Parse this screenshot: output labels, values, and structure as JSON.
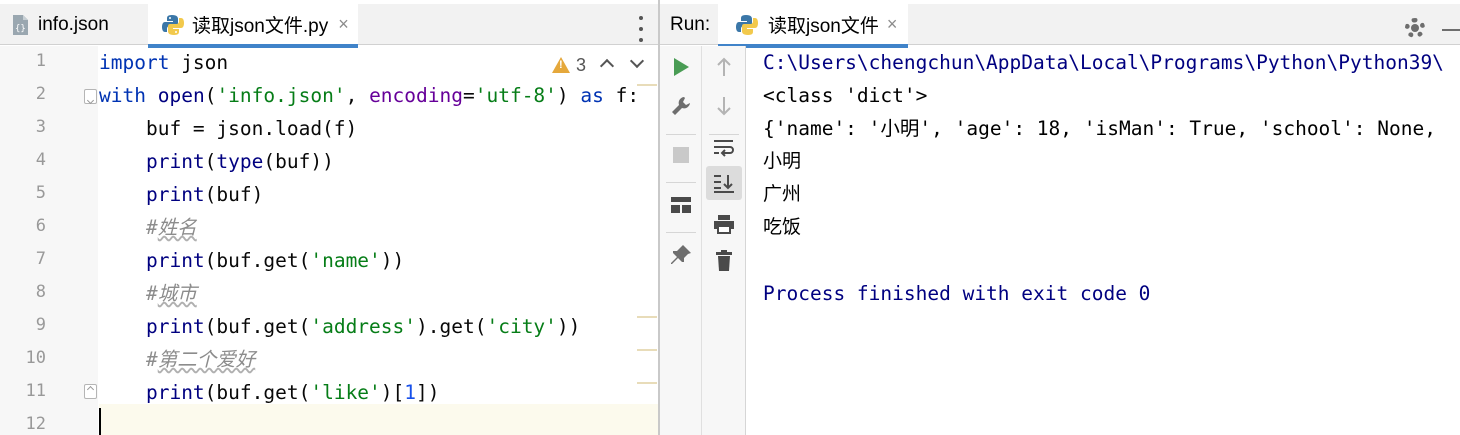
{
  "editor": {
    "tabs": [
      {
        "label": "info.json",
        "icon": "json-file-icon"
      },
      {
        "label": "读取json文件.py",
        "icon": "python-file-icon",
        "active": true
      }
    ],
    "close_glyph": "×",
    "inspections": {
      "warnings": "3"
    },
    "line_numbers": [
      "1",
      "2",
      "3",
      "4",
      "5",
      "6",
      "7",
      "8",
      "9",
      "10",
      "11",
      "12"
    ],
    "code": {
      "l1": {
        "k": "import",
        "rest": " json"
      },
      "l2": {
        "k1": "with",
        "sp1": " ",
        "fn": "open",
        "p1": "(",
        "s1": "'info.json'",
        "p2": ", ",
        "kwarg": "encoding",
        "eq": "=",
        "s2": "'utf-8'",
        "p3": ") ",
        "k2": "as",
        "p4": " f:"
      },
      "l3": {
        "text": "    buf = json.load(f)"
      },
      "l4": {
        "ind": "    ",
        "fn": "print",
        "p1": "(",
        "fn2": "type",
        "p2": "(buf))"
      },
      "l5": {
        "ind": "    ",
        "fn": "print",
        "p1": "(buf)"
      },
      "l6": {
        "ind": "    ",
        "hash": "#",
        "cn": "姓名"
      },
      "l7": {
        "ind": "    ",
        "fn": "print",
        "p1": "(buf.get(",
        "s": "'name'",
        "p2": "))"
      },
      "l8": {
        "ind": "    ",
        "hash": "#",
        "cn": "城市"
      },
      "l9": {
        "ind": "    ",
        "fn": "print",
        "p1": "(buf.get(",
        "s1": "'address'",
        "p2": ").get(",
        "s2": "'city'",
        "p3": "))"
      },
      "l10": {
        "ind": "    ",
        "hash": "#",
        "cn": "第二个爱好"
      },
      "l11": {
        "ind": "    ",
        "fn": "print",
        "p1": "(buf.get(",
        "s": "'like'",
        "p2": ")[",
        "n": "1",
        "p3": "])"
      }
    }
  },
  "run": {
    "title": "Run:",
    "tab_label": "读取json文件",
    "close_glyph": "×",
    "console": [
      "C:\\Users\\chengchun\\AppData\\Local\\Programs\\Python\\Python39\\",
      "<class 'dict'>",
      "{'name': '小明', 'age': 18, 'isMan': True, 'school': None,",
      "小明",
      "广州",
      "吃饭",
      "",
      "Process finished with exit code 0"
    ]
  },
  "colors": {
    "keyword": "#0033b3",
    "builtin": "#000080",
    "string": "#067d17",
    "number": "#1750eb",
    "comment": "#8c8c8c",
    "accent": "#4083c9",
    "run_green": "#499c54"
  }
}
